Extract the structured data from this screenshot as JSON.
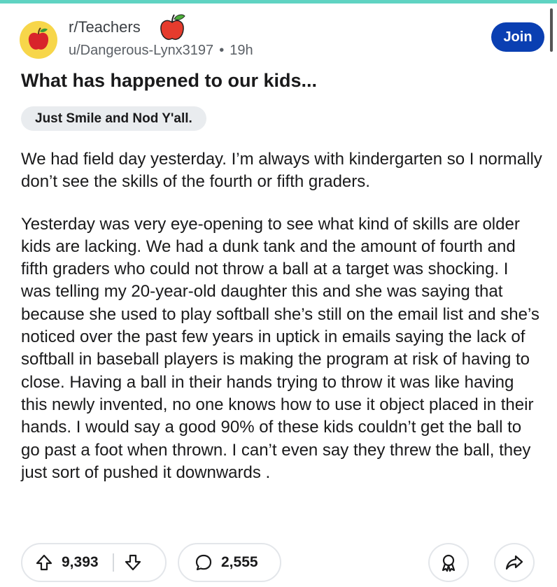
{
  "header": {
    "subreddit": "r/Teachers",
    "username": "u/Dangerous-Lynx3197",
    "separator": "•",
    "time": "19h",
    "join_label": "Join",
    "avatar_icon": "apple-icon",
    "brand_color": "#0a3fb2",
    "accent_bar_color": "#5fd3c2"
  },
  "post": {
    "title": "What has happened to our kids...",
    "flair": "Just Smile and Nod Y'all.",
    "paragraphs": [
      "We had field day yesterday. I’m always with kindergarten so I normally don’t see the skills of the fourth or fifth graders.",
      "Yesterday was very eye-opening to see what kind of skills are older kids are lacking. We had a dunk tank and the amount of fourth and fifth graders who could not throw a ball at a target was shocking. I was telling my 20-year-old daughter this and she was saying that because she used to play softball she’s still on the email list and she’s noticed over the past few years in uptick in emails saying the lack of softball in baseball players is making the program at risk of having to close. Having a ball in their hands trying to throw it was like having this newly invented, no one knows how to use it object placed in their hands. I would say a good 90% of these kids couldn’t get the ball to go past a foot when thrown. I can’t even say they threw the ball, they just sort of pushed it downwards ."
    ]
  },
  "actions": {
    "upvotes": "9,393",
    "comments": "2,555",
    "upvote_icon": "arrow-up-icon",
    "downvote_icon": "arrow-down-icon",
    "comment_icon": "comment-bubble-icon",
    "award_icon": "award-icon",
    "share_icon": "share-icon"
  }
}
